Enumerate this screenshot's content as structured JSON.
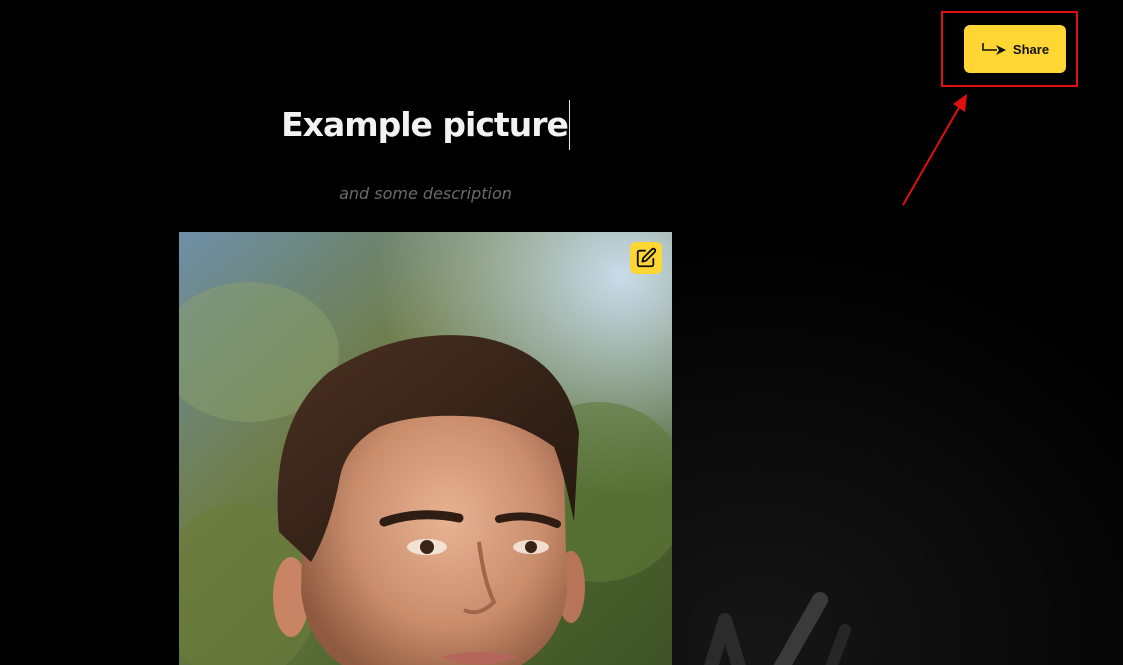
{
  "page": {
    "title": "Example picture",
    "description": "and some description"
  },
  "toolbar": {
    "share_label": "Share",
    "share_icon": "share-arrow-icon"
  },
  "photo": {
    "edit_icon": "edit-icon",
    "subject": "portrait-photo"
  },
  "annotation": {
    "highlight_color": "#e01010"
  },
  "colors": {
    "accent": "#ffd633",
    "background": "#000000",
    "title": "#f2f2f2",
    "description": "#6a6a6a"
  }
}
